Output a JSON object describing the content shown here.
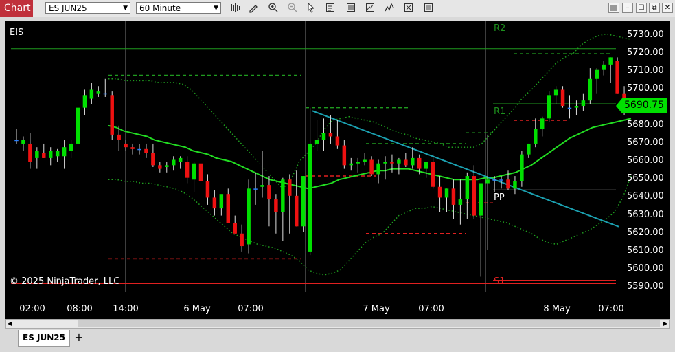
{
  "toolbar": {
    "chart_tab_label": "Chart",
    "instrument_value": "ES JUN25",
    "interval_value": "60 Minute"
  },
  "chart": {
    "instrument_label": "EIS",
    "copyright": "© 2025 NinjaTrader, LLC",
    "current_price": "5690.75",
    "pivot_labels": {
      "r2": "R2",
      "r1": "R1",
      "pp": "PP",
      "s1": "S1"
    },
    "price_ticks": [
      "5730.00",
      "5720.00",
      "5710.00",
      "5700.00",
      "5690.00",
      "5680.00",
      "5670.00",
      "5660.00",
      "5650.00",
      "5640.00",
      "5630.00",
      "5620.00",
      "5610.00",
      "5600.00",
      "5590.00"
    ],
    "time_ticks": [
      "02:00",
      "08:00",
      "14:00",
      "6 May",
      "07:00",
      "7 May",
      "07:00",
      "8 May",
      "07:00"
    ]
  },
  "tabs": {
    "instrument_tab": "ES JUN25",
    "add_tab": "+"
  },
  "colors": {
    "up": "#00e000",
    "down": "#ee1111",
    "flat": "#2a7fff",
    "sma": "#22dd22",
    "band": "#1fa01f",
    "trendline": "#1ba0b0",
    "price_badge": "#00e000"
  },
  "chart_data": {
    "type": "candlestick",
    "y_axis": {
      "min": 5585,
      "max": 5735,
      "ticks": [
        5730,
        5720,
        5710,
        5700,
        5690,
        5680,
        5670,
        5660,
        5650,
        5640,
        5630,
        5620,
        5610,
        5600,
        5590
      ]
    },
    "x_axis_labels": [
      "02:00",
      "08:00",
      "14:00",
      "6 May",
      "07:00",
      "7 May",
      "07:00",
      "8 May",
      "07:00"
    ],
    "current_price": 5690.75,
    "candles": [
      [
        5672,
        5678,
        5670,
        5672
      ],
      [
        5670,
        5674,
        5666,
        5672
      ],
      [
        5670,
        5676,
        5656,
        5660
      ],
      [
        5662,
        5668,
        5656,
        5666
      ],
      [
        5665,
        5670,
        5662,
        5662
      ],
      [
        5662,
        5668,
        5658,
        5666
      ],
      [
        5663,
        5667,
        5660,
        5666
      ],
      [
        5663,
        5672,
        5656,
        5668
      ],
      [
        5666,
        5672,
        5662,
        5670
      ],
      [
        5670,
        5690,
        5668,
        5690
      ],
      [
        5690,
        5700,
        5686,
        5697
      ],
      [
        5695,
        5704,
        5692,
        5700
      ],
      [
        5698,
        5702,
        5696,
        5699
      ],
      [
        5698,
        5706,
        5696,
        5698
      ],
      [
        5697,
        5699,
        5672,
        5675
      ],
      [
        5675,
        5680,
        5666,
        5672
      ],
      [
        5670,
        5672,
        5666,
        5668
      ],
      [
        5668,
        5670,
        5664,
        5667
      ],
      [
        5667,
        5670,
        5664,
        5667
      ],
      [
        5667,
        5670,
        5662,
        5665
      ],
      [
        5665,
        5670,
        5657,
        5658
      ],
      [
        5658,
        5660,
        5654,
        5656
      ],
      [
        5657,
        5660,
        5654,
        5658
      ],
      [
        5658,
        5663,
        5655,
        5661
      ],
      [
        5660,
        5663,
        5656,
        5662
      ],
      [
        5660,
        5663,
        5648,
        5651
      ],
      [
        5650,
        5660,
        5643,
        5659
      ],
      [
        5659,
        5662,
        5643,
        5649
      ],
      [
        5649,
        5653,
        5636,
        5640
      ],
      [
        5640,
        5644,
        5630,
        5634
      ],
      [
        5634,
        5640,
        5630,
        5642
      ],
      [
        5642,
        5645,
        5627,
        5626
      ],
      [
        5626,
        5630,
        5620,
        5620
      ],
      [
        5620,
        5625,
        5610,
        5613
      ],
      [
        5614,
        5650,
        5609,
        5645
      ],
      [
        5645,
        5654,
        5636,
        5645
      ],
      [
        5646,
        5666,
        5640,
        5647
      ],
      [
        5647,
        5652,
        5624,
        5639
      ],
      [
        5639,
        5642,
        5620,
        5632
      ],
      [
        5632,
        5651,
        5616,
        5650
      ],
      [
        5650,
        5653,
        5620,
        5641
      ],
      [
        5641,
        5655,
        5624,
        5624
      ],
      [
        5624,
        5652,
        5621,
        5652
      ],
      [
        5610,
        5690,
        5608,
        5670
      ],
      [
        5670,
        5683,
        5666,
        5672
      ],
      [
        5672,
        5684,
        5666,
        5676
      ],
      [
        5676,
        5686,
        5670,
        5674
      ],
      [
        5674,
        5683,
        5667,
        5669
      ],
      [
        5669,
        5672,
        5656,
        5658
      ],
      [
        5658,
        5662,
        5655,
        5659
      ],
      [
        5659,
        5662,
        5654,
        5660
      ],
      [
        5660,
        5665,
        5658,
        5661
      ],
      [
        5661,
        5663,
        5652,
        5653
      ],
      [
        5653,
        5661,
        5648,
        5659
      ],
      [
        5659,
        5663,
        5650,
        5660
      ],
      [
        5660,
        5664,
        5654,
        5659
      ],
      [
        5659,
        5662,
        5653,
        5661
      ],
      [
        5661,
        5665,
        5657,
        5658
      ],
      [
        5658,
        5668,
        5656,
        5662
      ],
      [
        5662,
        5664,
        5653,
        5656
      ],
      [
        5656,
        5660,
        5651,
        5660
      ],
      [
        5660,
        5664,
        5645,
        5646
      ],
      [
        5646,
        5652,
        5632,
        5640
      ],
      [
        5640,
        5645,
        5632,
        5645
      ],
      [
        5645,
        5650,
        5628,
        5636
      ],
      [
        5636,
        5650,
        5625,
        5639
      ],
      [
        5639,
        5654,
        5628,
        5652
      ],
      [
        5652,
        5658,
        5628,
        5630
      ],
      [
        5630,
        5646,
        5596,
        5648
      ],
      [
        5648,
        5675,
        5611,
        5650
      ],
      [
        5650,
        5652,
        5643,
        5650
      ],
      [
        5650,
        5652,
        5645,
        5650
      ],
      [
        5650,
        5655,
        5644,
        5645
      ],
      [
        5645,
        5652,
        5642,
        5649
      ],
      [
        5649,
        5666,
        5646,
        5664
      ],
      [
        5664,
        5670,
        5662,
        5670
      ],
      [
        5670,
        5684,
        5668,
        5678
      ],
      [
        5678,
        5685,
        5674,
        5684
      ],
      [
        5684,
        5699,
        5682,
        5697
      ],
      [
        5697,
        5702,
        5692,
        5700
      ],
      [
        5700,
        5702,
        5690,
        5691
      ],
      [
        5690,
        5697,
        5684,
        5690
      ],
      [
        5690,
        5694,
        5686,
        5691
      ],
      [
        5691,
        5698,
        5688,
        5694
      ],
      [
        5694,
        5712,
        5692,
        5706
      ],
      [
        5706,
        5712,
        5698,
        5711
      ],
      [
        5711,
        5716,
        5708,
        5714
      ],
      [
        5714,
        5718,
        5704,
        5718
      ],
      [
        5716,
        5718,
        5698,
        5698
      ],
      [
        5698,
        5702,
        5686,
        5691
      ],
      [
        5692,
        5694,
        5688,
        5690
      ]
    ],
    "sma": [
      5680,
      5679,
      5677,
      5676,
      5675,
      5674,
      5672,
      5671,
      5670,
      5669,
      5668,
      5666,
      5665,
      5664,
      5662,
      5661,
      5660,
      5658,
      5656,
      5654,
      5652,
      5650,
      5649,
      5648,
      5647,
      5646,
      5645,
      5646,
      5647,
      5648,
      5650,
      5651,
      5652,
      5653,
      5654,
      5655,
      5655,
      5656,
      5656,
      5656,
      5655,
      5654,
      5653,
      5652,
      5651,
      5650,
      5650,
      5650,
      5650,
      5651,
      5651,
      5652,
      5653,
      5654,
      5656,
      5658,
      5661,
      5664,
      5667,
      5670,
      5673,
      5675,
      5677,
      5679,
      5680,
      5681,
      5682,
      5683,
      5684
    ],
    "upper_band": [
      5706,
      5706,
      5705,
      5705,
      5705,
      5705,
      5704,
      5704,
      5704,
      5703,
      5700,
      5695,
      5690,
      5685,
      5680,
      5675,
      5670,
      5665,
      5660,
      5655,
      5650,
      5645,
      5650,
      5660,
      5665,
      5670,
      5678,
      5683,
      5684,
      5685,
      5684,
      5683,
      5682,
      5680,
      5678,
      5676,
      5675,
      5673,
      5672,
      5671,
      5670,
      5668,
      5668,
      5668,
      5668,
      5670,
      5675,
      5680,
      5685,
      5690,
      5696,
      5700,
      5705,
      5710,
      5715,
      5718,
      5720,
      5725,
      5728,
      5730,
      5731,
      5730,
      5729,
      5728
    ],
    "lower_band": [
      5650,
      5650,
      5649,
      5649,
      5648,
      5648,
      5647,
      5646,
      5645,
      5643,
      5640,
      5636,
      5632,
      5628,
      5624,
      5620,
      5618,
      5616,
      5614,
      5613,
      5612,
      5610,
      5608,
      5605,
      5600,
      5598,
      5597,
      5598,
      5600,
      5605,
      5610,
      5615,
      5618,
      5620,
      5625,
      5630,
      5632,
      5634,
      5634,
      5635,
      5634,
      5633,
      5632,
      5631,
      5630,
      5629,
      5628,
      5627,
      5626,
      5624,
      5622,
      5620,
      5617,
      5615,
      5614,
      5616,
      5618,
      5620,
      5622,
      5625,
      5628,
      5632,
      5640,
      5652
    ],
    "pivot_levels": {
      "R2": 5719,
      "R1": 5691,
      "PP": 5645,
      "S1": 5596
    },
    "trendline": [
      [
        5689,
        0.456
      ],
      [
        5625,
        0.925
      ]
    ]
  }
}
